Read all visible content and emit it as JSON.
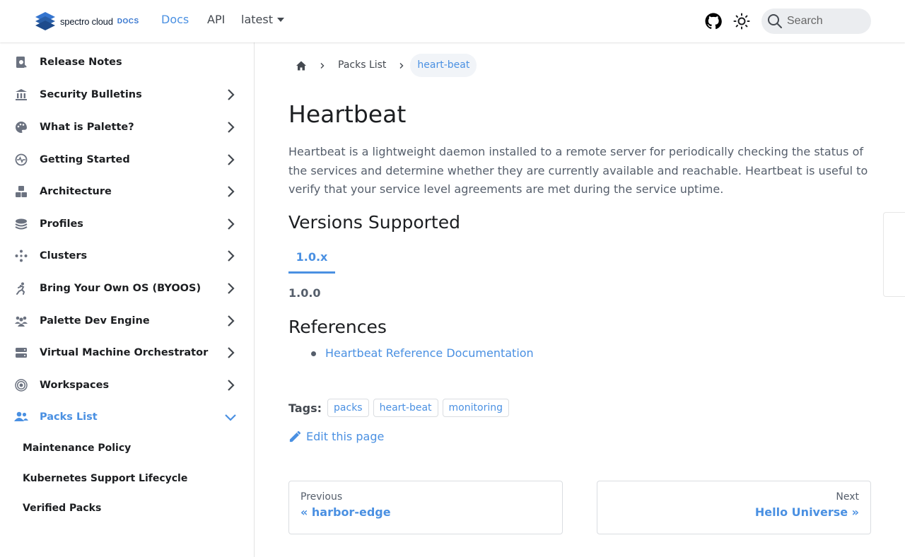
{
  "navbar": {
    "logo_text": "spectro cloud",
    "logo_docs": "DOCS",
    "links": [
      "Docs",
      "API"
    ],
    "version": "latest",
    "search_placeholder": "Search"
  },
  "sidebar": {
    "items": [
      {
        "label": "Release Notes",
        "icon": "release-notes-icon",
        "expandable": false
      },
      {
        "label": "Security Bulletins",
        "icon": "bank-icon",
        "expandable": true
      },
      {
        "label": "What is Palette?",
        "icon": "palette-icon",
        "expandable": true
      },
      {
        "label": "Getting Started",
        "icon": "heartbeat-icon",
        "expandable": true
      },
      {
        "label": "Architecture",
        "icon": "cubes-icon",
        "expandable": true
      },
      {
        "label": "Profiles",
        "icon": "layers-icon",
        "expandable": true
      },
      {
        "label": "Clusters",
        "icon": "clusters-icon",
        "expandable": true
      },
      {
        "label": "Bring Your Own OS (BYOOS)",
        "icon": "person-running-icon",
        "expandable": true
      },
      {
        "label": "Palette Dev Engine",
        "icon": "users-icon",
        "expandable": true
      },
      {
        "label": "Virtual Machine Orchestrator",
        "icon": "server-icon",
        "expandable": true
      },
      {
        "label": "Workspaces",
        "icon": "target-icon",
        "expandable": true
      },
      {
        "label": "Packs List",
        "icon": "user-group-icon",
        "expandable": true,
        "expanded": true
      }
    ],
    "sub_items": [
      "Maintenance Policy",
      "Kubernetes Support Lifecycle",
      "Verified Packs"
    ]
  },
  "breadcrumbs": [
    "Packs List",
    "heart-beat"
  ],
  "page": {
    "title": "Heartbeat",
    "intro": "Heartbeat is a lightweight daemon installed to a remote server for periodically checking the status of the services and determine whether they are currently available and reachable. Heartbeat is useful to verify that your service level agreements are met during the service uptime.",
    "versions_heading": "Versions Supported",
    "tab": "1.0.x",
    "version": "1.0.0",
    "references_heading": "References",
    "reference_link": "Heartbeat Reference Documentation",
    "tags_label": "Tags:",
    "tags": [
      "packs",
      "heart-beat",
      "monitoring"
    ],
    "edit_label": "Edit this page"
  },
  "pager": {
    "prev_sub": "Previous",
    "prev_label": "« harbor-edge",
    "next_sub": "Next",
    "next_label": "Hello Universe »"
  },
  "colors": {
    "accent": "#4a90e2",
    "text": "#1c1e21",
    "muted": "#555e6b"
  }
}
